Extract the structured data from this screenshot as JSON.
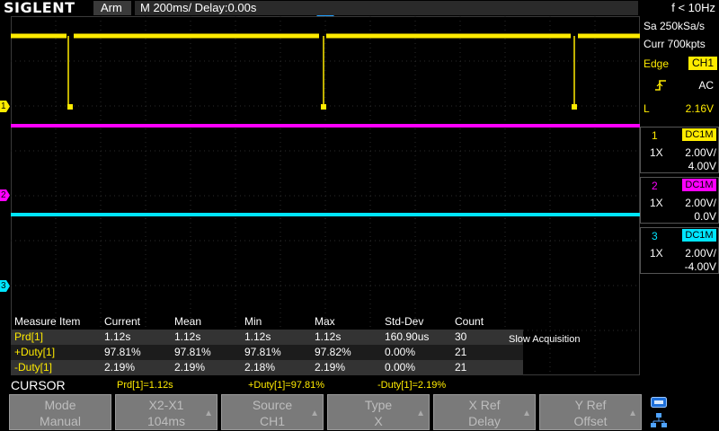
{
  "header": {
    "logo": "SIGLENT",
    "status": "Arm",
    "timebase": "M 200ms/  Delay:0.00s",
    "freq": "f < 10Hz"
  },
  "right_panel": {
    "sample_rate": "Sa 250kSa/s",
    "memory": "Curr 700kpts",
    "trigger": {
      "type": "Edge",
      "source": "CH1",
      "coupling": "AC",
      "level_label": "L",
      "level": "2.16V"
    },
    "channels": [
      {
        "num": "1",
        "coupling": "DC1M",
        "probe": "1X",
        "scale": "2.00V/",
        "offset": "4.00V",
        "color": "#ffeb00"
      },
      {
        "num": "2",
        "coupling": "DC1M",
        "probe": "1X",
        "scale": "2.00V/",
        "offset": "0.0V",
        "color": "#ff00ff"
      },
      {
        "num": "3",
        "coupling": "DC1M",
        "probe": "1X",
        "scale": "2.00V/",
        "offset": "-4.00V",
        "color": "#00e5ff"
      }
    ]
  },
  "markers": {
    "ch1": "1",
    "ch2": "2",
    "ch3": "3"
  },
  "measure": {
    "headers": [
      "Measure Item",
      "Current",
      "Mean",
      "Min",
      "Max",
      "Std-Dev",
      "Count"
    ],
    "rows": [
      [
        "Prd[1]",
        "1.12s",
        "1.12s",
        "1.12s",
        "1.12s",
        "160.90us",
        "30"
      ],
      [
        "+Duty[1]",
        "97.81%",
        "97.81%",
        "97.81%",
        "97.82%",
        "0.00%",
        "21"
      ],
      [
        "-Duty[1]",
        "2.19%",
        "2.19%",
        "2.18%",
        "2.19%",
        "0.00%",
        "21"
      ]
    ],
    "slow_acquisition": "Slow Acquisition"
  },
  "cursor": {
    "label": "CURSOR",
    "values": [
      "Prd[1]=1.12s",
      "+Duty[1]=97.81%",
      "-Duty[1]=2.19%"
    ]
  },
  "softkeys": [
    {
      "top": "Mode",
      "bottom": "Manual"
    },
    {
      "top": "X2-X1",
      "bottom": "104ms"
    },
    {
      "top": "Source",
      "bottom": "CH1"
    },
    {
      "top": "Type",
      "bottom": "X"
    },
    {
      "top": "X Ref",
      "bottom": "Delay"
    },
    {
      "top": "Y Ref",
      "bottom": "Offset"
    }
  ],
  "icons": [
    "usb-icon",
    "network-icon"
  ]
}
